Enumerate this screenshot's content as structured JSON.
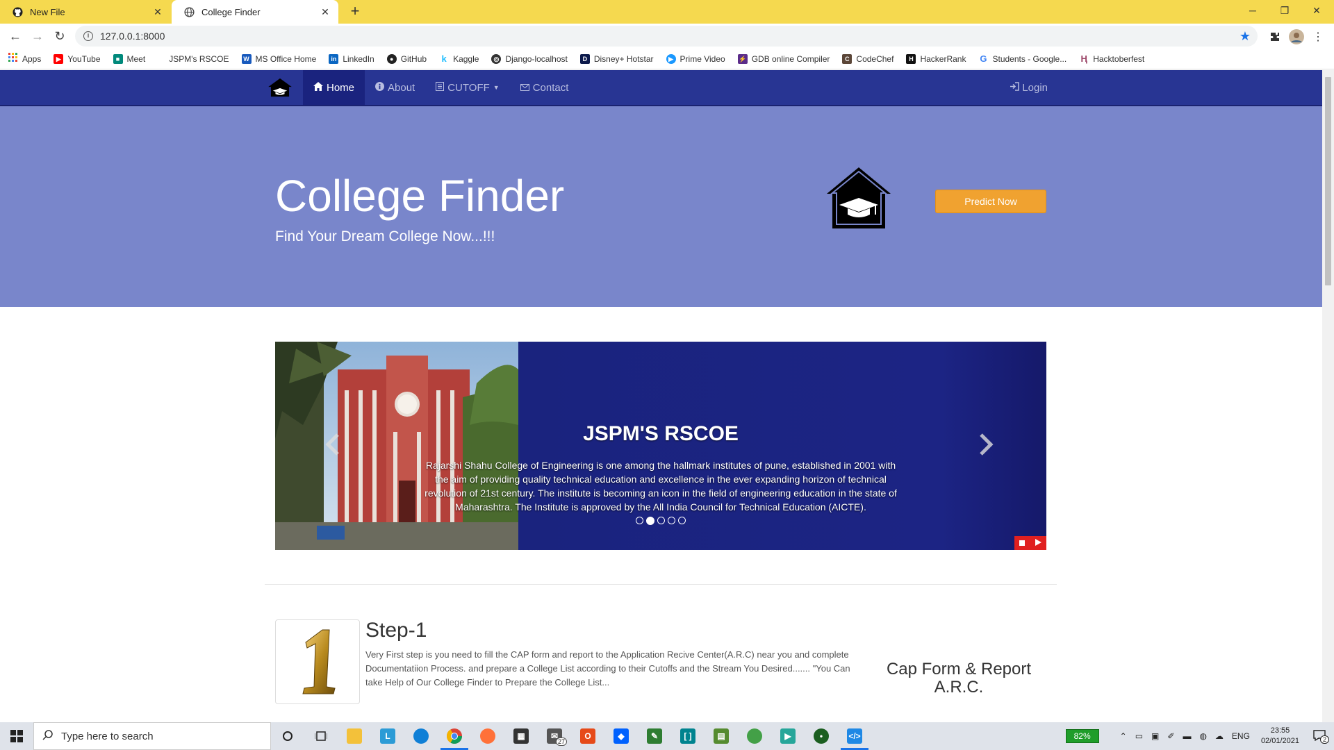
{
  "browser": {
    "tabs": [
      {
        "title": "New File",
        "active": false
      },
      {
        "title": "College Finder",
        "active": true
      }
    ],
    "url": "127.0.0.1:8000",
    "bookmarks": [
      {
        "label": "Apps",
        "color": "#ea4335"
      },
      {
        "label": "YouTube",
        "color": "#ff0000"
      },
      {
        "label": "Meet",
        "color": "#00897b"
      },
      {
        "label": "JSPM's RSCOE",
        "color": "#ffffff"
      },
      {
        "label": "MS Office Home",
        "color": "#185abd"
      },
      {
        "label": "LinkedIn",
        "color": "#0a66c2"
      },
      {
        "label": "GitHub",
        "color": "#222222"
      },
      {
        "label": "Kaggle",
        "color": "#20beff"
      },
      {
        "label": "Django-localhost",
        "color": "#333333"
      },
      {
        "label": "Disney+ Hotstar",
        "color": "#0c1a4b"
      },
      {
        "label": "Prime Video",
        "color": "#1a98ff"
      },
      {
        "label": "GDB online Compiler",
        "color": "#5b2c8a"
      },
      {
        "label": "CodeChef",
        "color": "#5b4638"
      },
      {
        "label": "HackerRank",
        "color": "#111111"
      },
      {
        "label": "Students - Google...",
        "color": "#4285f4"
      },
      {
        "label": "Hacktoberfest",
        "color": "#9c4668"
      }
    ]
  },
  "site": {
    "nav": {
      "home": "Home",
      "about": "About",
      "cutoff": "CUTOFF",
      "contact": "Contact",
      "login": "Login"
    },
    "hero": {
      "title": "College Finder",
      "subtitle": "Find Your Dream College Now...!!!",
      "cta": "Predict Now"
    },
    "carousel": {
      "heading": "JSPM'S RSCOE",
      "text": "Rajarshi Shahu College of Engineering is one among the hallmark institutes of pune, established in 2001 with the aim of providing quality technical education and excellence in the ever expanding horizon of technical revolution of 21st century. The institute is becoming an icon in the field of engineering education in the state of Maharashtra. The Institute is approved by the All India Council for Technical Education (AICTE).",
      "slides_total": 5,
      "active_slide": 2
    },
    "step1": {
      "number": "1",
      "title": "Step-1",
      "text": "Very First step is you need to fill the CAP form and report to the Application Recive Center(A.R.C) near you and complete Documentatiion Process. and prepare a College List according to their Cutoffs and the Stream You Desired....... \"You Can take Help of Our College Finder to Prepare the College List...",
      "side_line1": "Cap Form & Report",
      "side_line2": "A.R.C."
    },
    "colors": {
      "navbar": "#283593",
      "hero": "#7986cb",
      "cta": "#f0a230",
      "carousel": "#1a237e"
    }
  },
  "taskbar": {
    "search_placeholder": "Type here to search",
    "mail_badge": "27",
    "battery": "82%",
    "lang": "ENG",
    "time": "23:55",
    "date": "02/01/2021",
    "notif_count": "2"
  }
}
